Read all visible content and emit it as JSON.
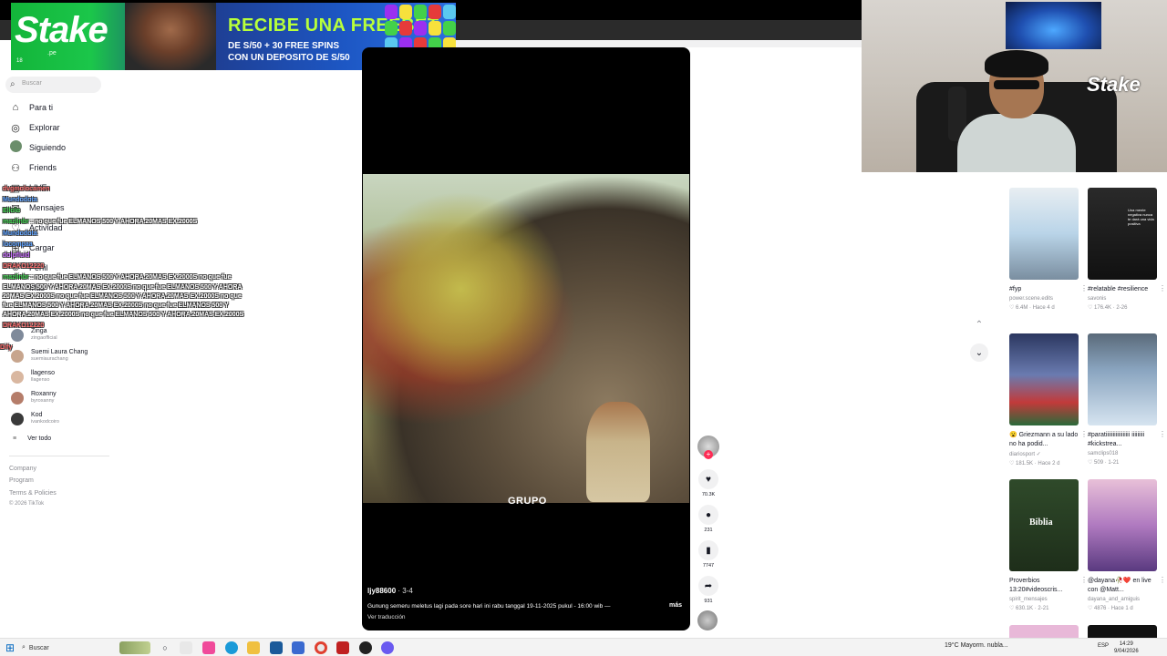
{
  "banner": {
    "logo": "Stake",
    "logo_sub": ".pe",
    "headline": "RECIBE UNA FREEBET",
    "line1": "DE S/50 + 30 FREE SPINS",
    "line2": "CON UN DEPOSITO DE S/50",
    "fine": "18"
  },
  "search": {
    "placeholder": "Buscar"
  },
  "nav": [
    {
      "label": "Para ti",
      "icon": "home-icon"
    },
    {
      "label": "Explorar",
      "icon": "compass-icon"
    },
    {
      "label": "Siguiendo",
      "icon": "following-avatar"
    },
    {
      "label": "Friends",
      "icon": "friends-icon"
    },
    {
      "label": "LIVE",
      "icon": "live-icon"
    },
    {
      "label": "Mensajes",
      "icon": "message-icon"
    },
    {
      "label": "Actividad",
      "icon": "activity-icon"
    },
    {
      "label": "Cargar",
      "icon": "upload-icon"
    },
    {
      "label": "Perfil",
      "icon": "profile-icon"
    },
    {
      "label": "Más",
      "icon": "more-icon"
    }
  ],
  "chat": [
    {
      "user": "dvgmolocamen",
      "text": ""
    },
    {
      "user": "Mundodota",
      "text": ""
    },
    {
      "user": "Ellolo",
      "text": ""
    },
    {
      "user": "mazlinbr",
      "text": "no que fue ELMANOS 500 Y AHORA 20MAS EX 2000S"
    },
    {
      "user": "Mundodota",
      "text": ""
    },
    {
      "user": "locompaa",
      "text": ""
    },
    {
      "user": "dolpfluid",
      "text": ""
    },
    {
      "user": "DRAKO12220",
      "text": ""
    },
    {
      "user": "mazlinbr",
      "text": "no que fue ELMANOS 500 Y AHORA 20MAS EX 2000S no que fue"
    },
    {
      "user": "",
      "text": "ELMANOS 500 Y AHORA 20MAS EX 2000S no que fue ELMANOS 500 Y AHORA"
    },
    {
      "user": "",
      "text": "20MAS EX 2000S no que fue ELMANOS 500 Y AHORA 20MAS EX 2000S no que"
    },
    {
      "user": "",
      "text": "fue ELMANOS 500 Y AHORA 20MAS EX 2000S no que fue ELMANOS 500 Y"
    },
    {
      "user": "",
      "text": "AHORA 20MAS EX 2000S no que fue ELMANOS 500 Y AHORA 20MAS EX 2000S"
    },
    {
      "user": "DRAKO12220",
      "text": ""
    },
    {
      "user": "Dify",
      "text": ""
    }
  ],
  "following": [
    {
      "name": "Zinga",
      "handle": "zingaofficial"
    },
    {
      "name": "Suemi Laura Chang",
      "handle": "suemiaurachang"
    },
    {
      "name": "llagenso",
      "handle": "llagenso"
    },
    {
      "name": "Roxanny",
      "handle": "byroxanny"
    },
    {
      "name": "Kod",
      "handle": "ivankodcoiro"
    }
  ],
  "ver_todo": "Ver todo",
  "footer": [
    "Company",
    "Program",
    "Terms & Policies",
    "© 2026 TikTok"
  ],
  "video": {
    "caption_word": "GRUPO",
    "author": "ljy88600",
    "date": " · 3-4",
    "description": "Gunung semeru meletus lagi pada sore hari ini rabu tanggal 19-11-2025 pukul - 16:00 wib —",
    "more": "más",
    "translate": "Ver traducción"
  },
  "actions": {
    "likes": "70.3K",
    "comments": "231",
    "saves": "7747",
    "shares": "931"
  },
  "webcam": {
    "brand": "Stake"
  },
  "grid": [
    {
      "title": "#fyp",
      "author": "power.scene.edits",
      "meta": "♡ 6.4M · Hace 4 d",
      "colors": [
        "#b9d4e8",
        "#f2f2f2"
      ]
    },
    {
      "title": "#relatable #resilience",
      "author": "savonis",
      "meta": "♡ 176.4K · 2-26",
      "colors": [
        "#1a1a1a",
        "#3a3a3a"
      ]
    },
    {
      "title": "😮 Griezmann a su lado no ha podid...",
      "author": "diariosport ✓",
      "meta": "♡ 181.5K · Hace 2 d",
      "colors": [
        "#2a3a6a",
        "#c23a3a"
      ]
    },
    {
      "title": "#paratiiiiiiiiiiiiiiiii iiiiiiiii #kickstrea...",
      "author": "samclips018",
      "meta": "♡ 509 · 1-21",
      "colors": [
        "#4a5a6a",
        "#a9c6e0"
      ]
    },
    {
      "title": "Proverbios 13:20#videoscris...",
      "author": "spirit_mensajes",
      "meta": "♡ 630.1K · 2-21",
      "colors": [
        "#1e3a1e",
        "#4d6a3a"
      ]
    },
    {
      "title": "@dayana🥀❤️ en live con @Matt...",
      "author": "dayana_and_amiguis",
      "meta": "♡ 4876 · Hace 1 d",
      "colors": [
        "#c98bd1",
        "#7a4aa0"
      ]
    }
  ],
  "grid_overlays": {
    "biblia": "Biblia",
    "thumb2_text": "Una mente negativa nunca te dará una vida positiva"
  },
  "taskbar": {
    "search": "Buscar",
    "weather": "19°C  Mayorm. nubla...",
    "lang": "ESP",
    "time": "14:29",
    "date": "9/04/2026"
  }
}
